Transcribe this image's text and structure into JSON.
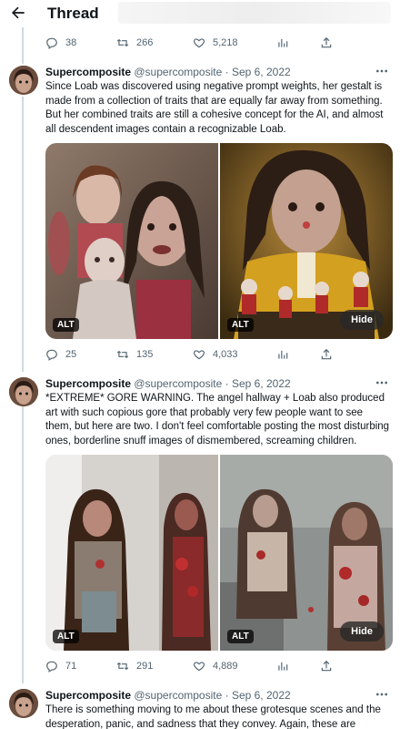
{
  "header": {
    "title": "Thread"
  },
  "top_actions": {
    "replies": "38",
    "retweets": "266",
    "likes": "5,218"
  },
  "tweets": [
    {
      "name": "Supercomposite",
      "handle": "@supercomposite",
      "date": "· Sep 6, 2022",
      "text": "Since Loab was discovered using negative prompt weights, her gestalt is made from a collection of traits that are equally far away from something. But her combined traits are still a cohesive concept for the AI, and almost all descendent images contain a recognizable Loab.",
      "alt_label": "ALT",
      "hide_label": "Hide",
      "replies": "25",
      "retweets": "135",
      "likes": "4,033"
    },
    {
      "name": "Supercomposite",
      "handle": "@supercomposite",
      "date": "· Sep 6, 2022",
      "text": "*EXTREME* GORE WARNING. The angel hallway + Loab also produced art with such copious gore that probably very few people want to see them, but here are two. I don't feel comfortable posting the most disturbing ones, borderline snuff images of dismembered, screaming children.",
      "alt_label": "ALT",
      "hide_label": "Hide",
      "replies": "71",
      "retweets": "291",
      "likes": "4,889"
    },
    {
      "name": "Supercomposite",
      "handle": "@supercomposite",
      "date": "· Sep 6, 2022",
      "text": "There is something moving to me about these grotesque scenes and the desperation, panic, and sadness that they convey. Again, these are"
    }
  ],
  "colors": {
    "text": "#0f1419",
    "secondary": "#536471",
    "thread_line": "#cfd9de"
  },
  "icons": [
    "back-arrow-icon",
    "reply-icon",
    "retweet-icon",
    "like-icon",
    "views-icon",
    "share-icon",
    "more-icon"
  ]
}
